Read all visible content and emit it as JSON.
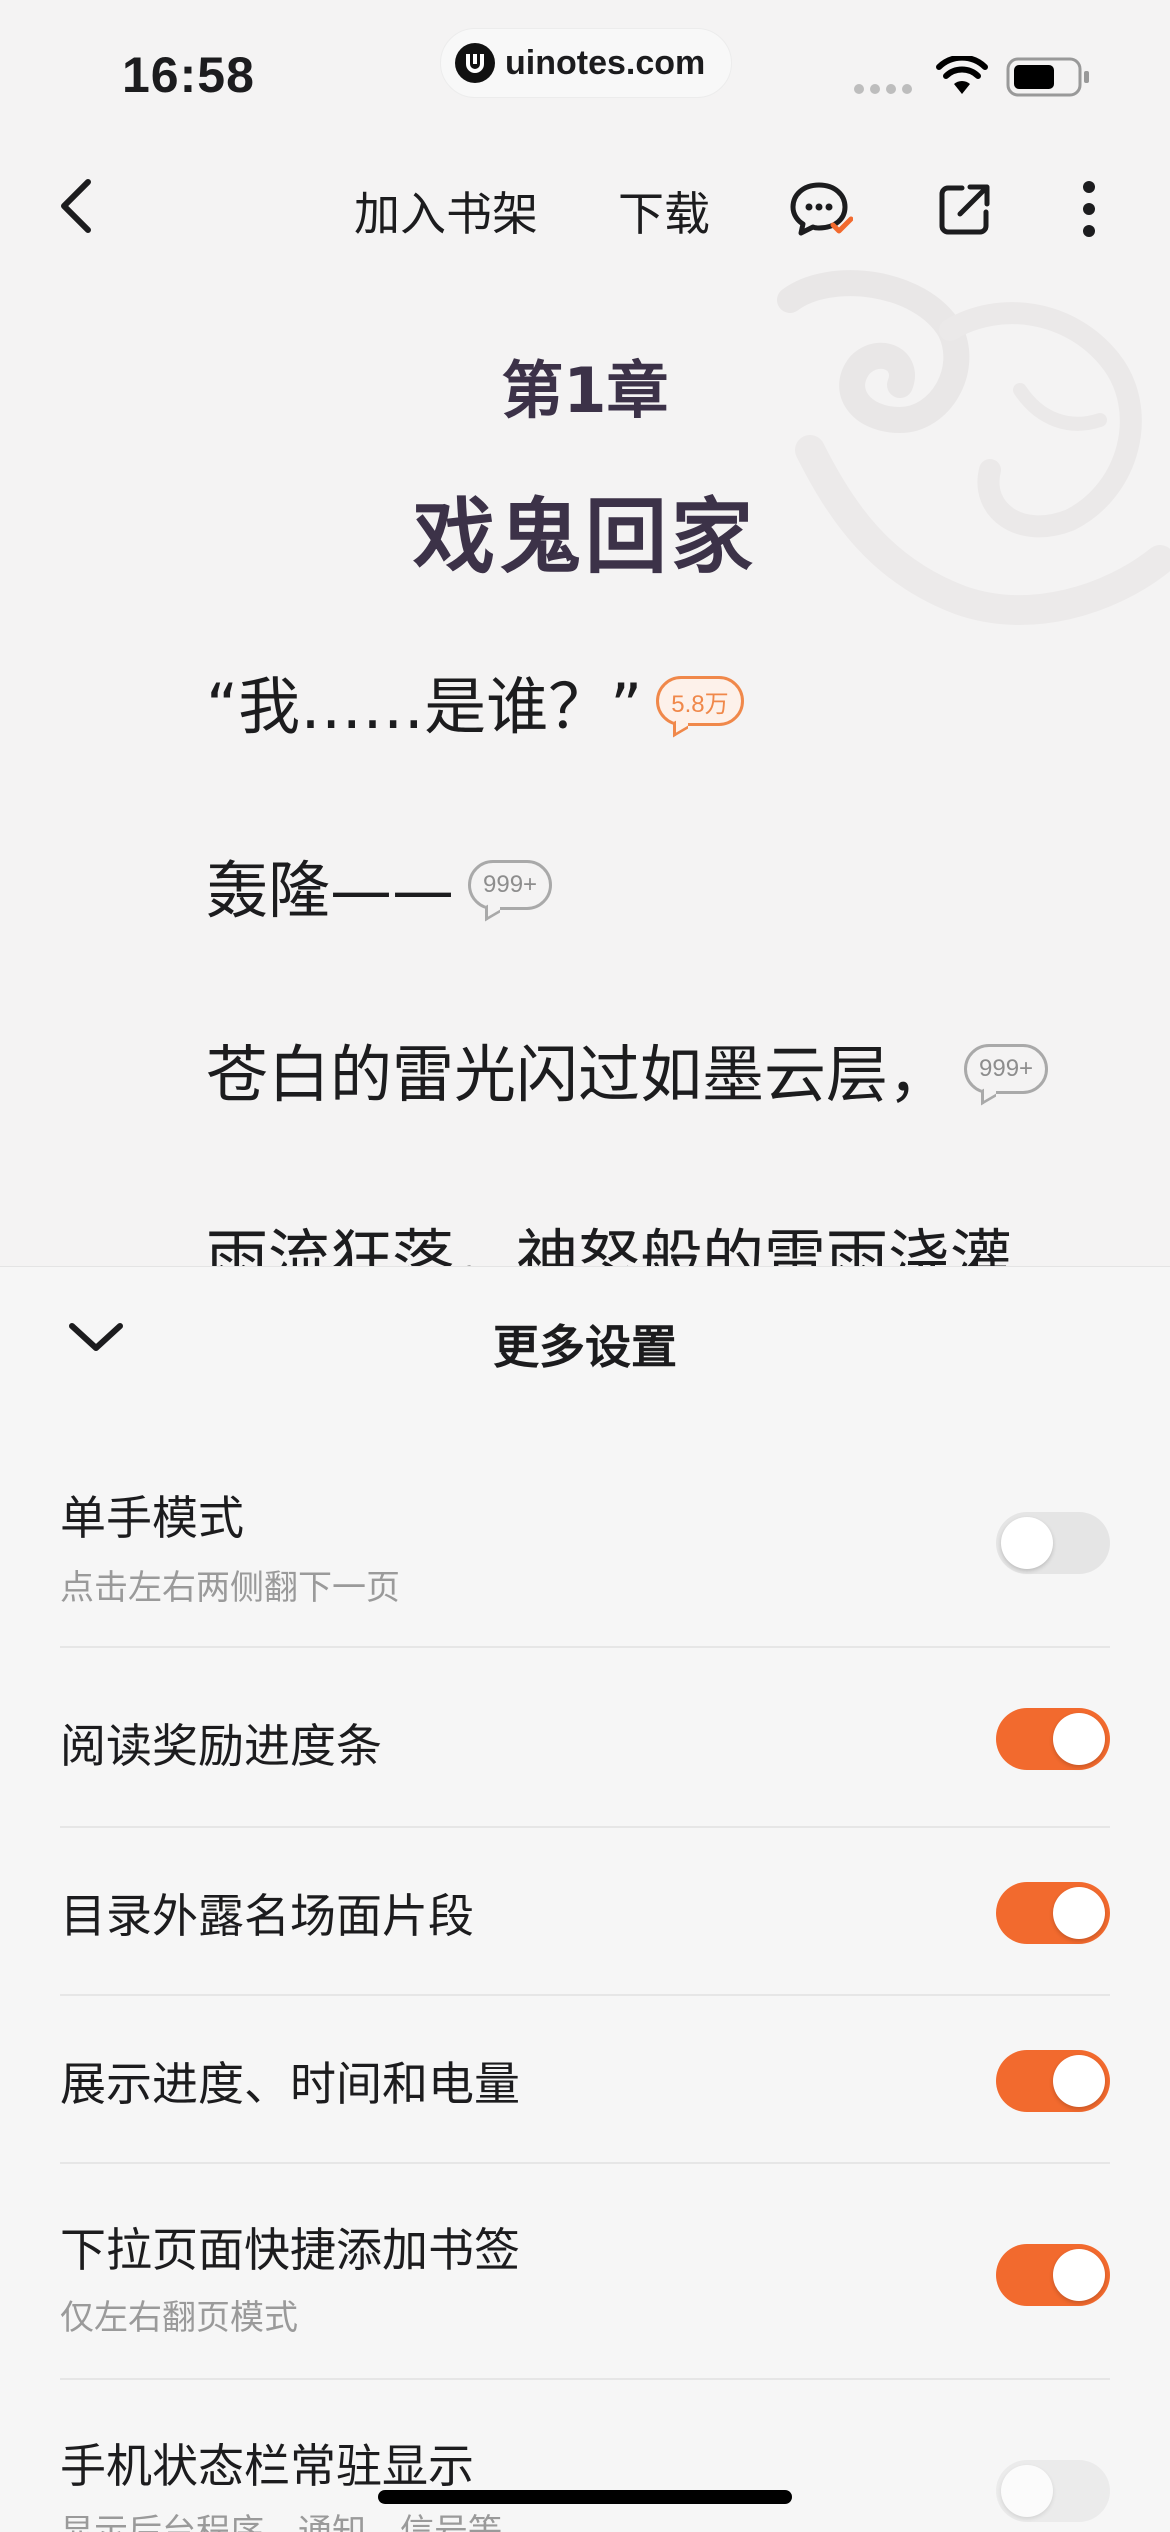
{
  "status_bar": {
    "time": "16:58",
    "url": "uinotes.com"
  },
  "toolbar": {
    "add_to_shelf": "加入书架",
    "download": "下载",
    "icons": [
      "back-chevron-icon",
      "comment-check-icon",
      "share-icon",
      "more-vertical-icon"
    ]
  },
  "reader": {
    "chapter_number": "第1章",
    "chapter_title": "戏鬼回家",
    "paragraphs": [
      {
        "text": "“我……是谁？”",
        "comment_count": "5.8万",
        "highlight": true
      },
      {
        "text": "轰隆——",
        "comment_count": "999+",
        "highlight": false
      },
      {
        "text": "苍白的雷光闪过如墨云层，",
        "comment_count": "999+",
        "highlight": false
      },
      {
        "text": "雨流狂落，神怒般的雷雨浇灌",
        "comment_count": "",
        "highlight": false
      }
    ]
  },
  "settings": {
    "title": "更多设置",
    "rows": [
      {
        "title": "单手模式",
        "subtitle": "点击左右两侧翻下一页",
        "enabled": false
      },
      {
        "title": "阅读奖励进度条",
        "subtitle": "",
        "enabled": true
      },
      {
        "title": "目录外露名场面片段",
        "subtitle": "",
        "enabled": true
      },
      {
        "title": "展示进度、时间和电量",
        "subtitle": "",
        "enabled": true
      },
      {
        "title": "下拉页面快捷添加书签",
        "subtitle": "仅左右翻页模式",
        "enabled": true
      },
      {
        "title": "手机状态栏常驻显示",
        "subtitle": "显示后台程序、通知、信号等",
        "enabled": false
      }
    ]
  },
  "colors": {
    "accent": "#f26a2e",
    "chapter_heading": "#3c3248",
    "comment_highlight": "#f0884a",
    "background": "#f4f3f3"
  }
}
